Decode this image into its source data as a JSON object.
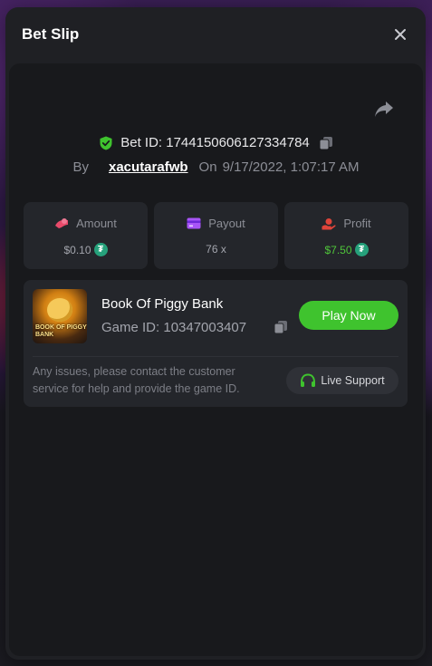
{
  "modal": {
    "title": "Bet Slip"
  },
  "bet": {
    "id_label": "Bet ID: 1744150606127334784",
    "by_label": "By",
    "username": "xacutarafwb",
    "on_label": "On",
    "datetime": "9/17/2022, 1:07:17 AM"
  },
  "stats": {
    "amount_label": "Amount",
    "amount_value": "$0.10",
    "payout_label": "Payout",
    "payout_value": "76 x",
    "profit_label": "Profit",
    "profit_value": "$7.50"
  },
  "game": {
    "name": "Book Of Piggy Bank",
    "id_label": "Game ID: 10347003407",
    "thumb_text": "BOOK OF PIGGY BANK",
    "play_label": "Play Now",
    "help_text": "Any issues, please contact the customer service for help and provide the game ID.",
    "support_label": "Live Support"
  },
  "colors": {
    "accent_green": "#3fc32e",
    "profit_green": "#4fc63a",
    "amount_pink": "#e84a6a",
    "payout_purple": "#a855f7",
    "profit_red": "#e0443a",
    "tether": "#26a17b"
  },
  "icons": {
    "close": "close-icon",
    "share": "share-icon",
    "verified": "shield-check-icon",
    "copy": "copy-icon",
    "amount": "amount-icon",
    "payout": "card-icon",
    "profit": "hand-coin-icon",
    "coin": "tether-icon",
    "support": "headset-icon"
  }
}
